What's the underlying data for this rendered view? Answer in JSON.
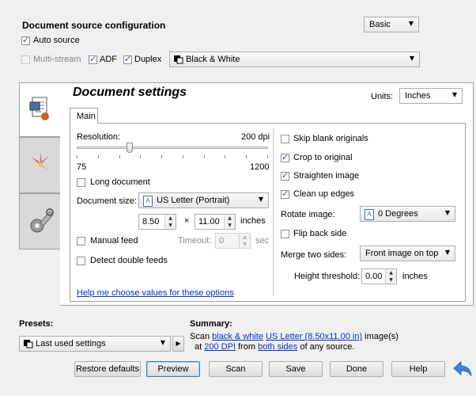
{
  "source": {
    "title": "Document source configuration",
    "mode_select": "Basic",
    "auto_source": "Auto source",
    "multi_stream": "Multi-stream",
    "adf": "ADF",
    "duplex": "Duplex",
    "color_mode": "Black & White"
  },
  "document": {
    "title": "Document settings",
    "units_label": "Units:",
    "units_value": "Inches",
    "tab_main": "Main"
  },
  "left": {
    "resolution_label": "Resolution:",
    "resolution_value": "200 dpi",
    "slider_min": "75",
    "slider_max": "1200",
    "slider_level": 0.27,
    "long_document": "Long document",
    "doc_size_label": "Document size:",
    "doc_size_value": "US Letter (Portrait)",
    "width_value": "8.50",
    "times": "×",
    "height_value": "11.00",
    "size_units": "inches",
    "manual_feed": "Manual feed",
    "timeout_label": "Timeout:",
    "timeout_value": "0",
    "timeout_units": "sec",
    "detect_double_feeds": "Detect double feeds",
    "help_link": "Help me choose values for these options"
  },
  "right": {
    "skip_blank": "Skip blank originals",
    "crop": "Crop to original",
    "straighten": "Straighten image",
    "clean_edges": "Clean up edges",
    "rotate_label": "Rotate image:",
    "rotate_value": "0 Degrees",
    "flip_back": "Flip back side",
    "merge_label": "Merge two sides:",
    "merge_value": "Front image on top",
    "height_threshold_label": "Height threshold:",
    "height_threshold_value": "0.00",
    "height_threshold_units": "inches"
  },
  "bottom": {
    "presets_label": "Presets:",
    "presets_value": "Last used settings",
    "summary_label": "Summary:",
    "summary_scan": "Scan",
    "summary_bw": "black & white",
    "summary_size": "US Letter (8.50x11.00 in)",
    "summary_images": "image(s)",
    "summary_at": "at",
    "summary_dpi": "200 DPI",
    "summary_from": "from",
    "summary_sides": "both sides",
    "summary_tail": "of any source."
  },
  "buttons": {
    "restore": "Restore defaults",
    "preview": "Preview",
    "scan": "Scan",
    "save": "Save",
    "done": "Done",
    "help": "Help"
  },
  "colors": {
    "accent": "#2e5c9e",
    "link": "#0033cc",
    "back_arrow": "#3d86d6"
  }
}
